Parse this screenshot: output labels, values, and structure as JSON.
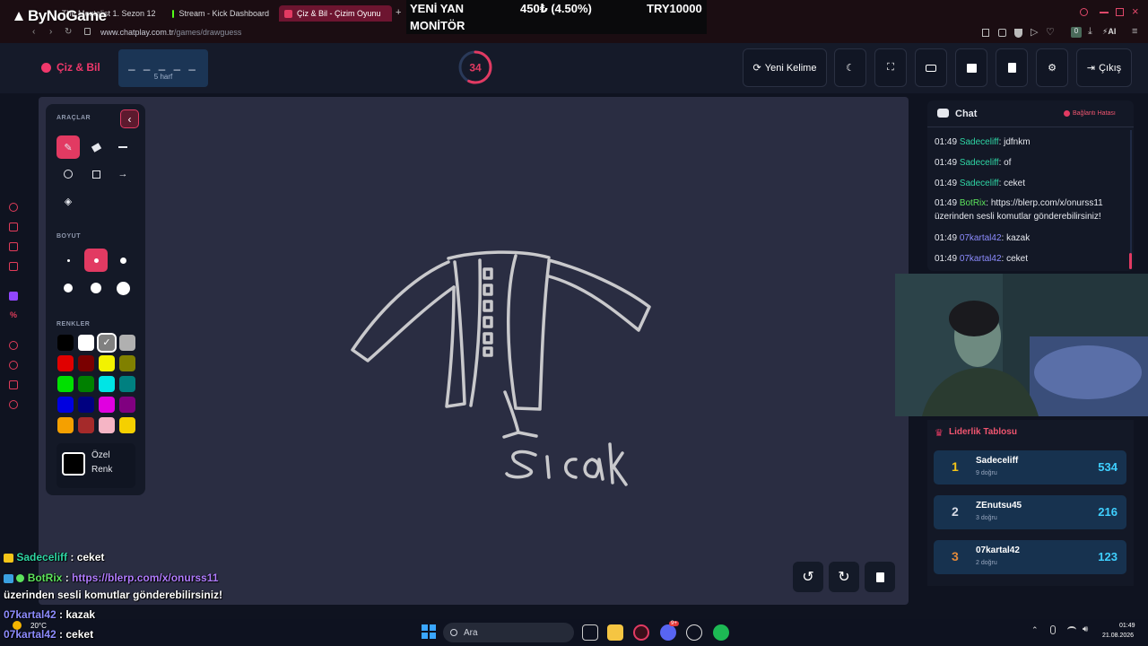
{
  "browser": {
    "tabs": [
      {
        "label": "The Mentalist 1. Sezon 12.",
        "fav": "#c44"
      },
      {
        "label": "Stream - Kick Dashboard",
        "fav": "#53fc18"
      },
      {
        "label": "Çiz & Bil - Çizim Oyunu",
        "fav": "#e23a62"
      }
    ],
    "new_tab": "+",
    "url_host": "www.chatplay.com.tr",
    "url_path": "/games/drawguess",
    "ai_label": "AI"
  },
  "ticker": {
    "line1": "YENİ YAN",
    "line2": "MONİTÖR",
    "price": "450₺ (4.50%)",
    "target": "TRY10000"
  },
  "logo": {
    "text": "ByNoGame"
  },
  "header": {
    "brand": "Çiz & Bil",
    "word_dashes": "_ _ _ _ _",
    "word_hint": "5 harf",
    "timer": "34",
    "timer_fraction": 0.57,
    "new_word": "Yeni Kelime",
    "logout": "Çıkış"
  },
  "tools": {
    "section_tools": "ARAÇLAR",
    "section_size": "BOYUT",
    "section_colors": "RENKLER",
    "custom_line1": "Özel",
    "custom_line2": "Renk",
    "colors": [
      "#000000",
      "#ffffff",
      "#808080",
      "#b0b0b0",
      "#e00000",
      "#7a0000",
      "#f2f200",
      "#808000",
      "#00e000",
      "#008000",
      "#00e5e5",
      "#008080",
      "#0000e0",
      "#000080",
      "#e000e0",
      "#800080",
      "#f5a000",
      "#a52a2a",
      "#f5b5c5",
      "#f5d000"
    ]
  },
  "drawing": {
    "text": "Sıcak"
  },
  "chat": {
    "title": "Chat",
    "status": "Bağlantı Hatası",
    "messages": [
      {
        "time": "01:49",
        "user": "Sadeceliff",
        "color": "#2fd6a5",
        "text": ": jdfnkm"
      },
      {
        "time": "01:49",
        "user": "Sadeceliff",
        "color": "#2fd6a5",
        "text": ": of"
      },
      {
        "time": "01:49",
        "user": "Sadeceliff",
        "color": "#2fd6a5",
        "text": ": ceket"
      },
      {
        "time": "01:49",
        "user": "BotRix",
        "color": "#5de35d",
        "text": ": https://blerp.com/x/onurss11 üzerinden sesli komutlar gönderebilirsiniz!"
      },
      {
        "time": "01:49",
        "user": "07kartal42",
        "color": "#8d8cff",
        "text": ": kazak"
      },
      {
        "time": "01:49",
        "user": "07kartal42",
        "color": "#8d8cff",
        "text": ": ceket"
      }
    ]
  },
  "leaderboard": {
    "title": "Liderlik Tablosu",
    "rows": [
      {
        "rank": "1",
        "name": "Sadeceliff",
        "sub": "9 doğru",
        "score": "534",
        "rank_color": "#f5c518"
      },
      {
        "rank": "2",
        "name": "ZEnutsu45",
        "sub": "3 doğru",
        "score": "216",
        "rank_color": "#d7dbe5"
      },
      {
        "rank": "3",
        "name": "07kartal42",
        "sub": "2 doğru",
        "score": "123",
        "rank_color": "#e38a3a"
      }
    ]
  },
  "overlay": {
    "l1_user": "Sadeceliff",
    "l1_text": " : ceket",
    "l2_user": "BotRix",
    "l2_sep": " : ",
    "l2_link": "https://blerp.com/x/onurss11",
    "l3_text": "üzerinden sesli komutlar gönderebilirsiniz!",
    "l4_user": "07kartal42",
    "l4_text": " : kazak",
    "l5_user": "07kartal42",
    "l5_text": " : ceket"
  },
  "taskbar": {
    "weather": "20°C",
    "search": "Ara",
    "time": "01:49",
    "date": "21.08.2026",
    "discord_badge": "9+"
  }
}
